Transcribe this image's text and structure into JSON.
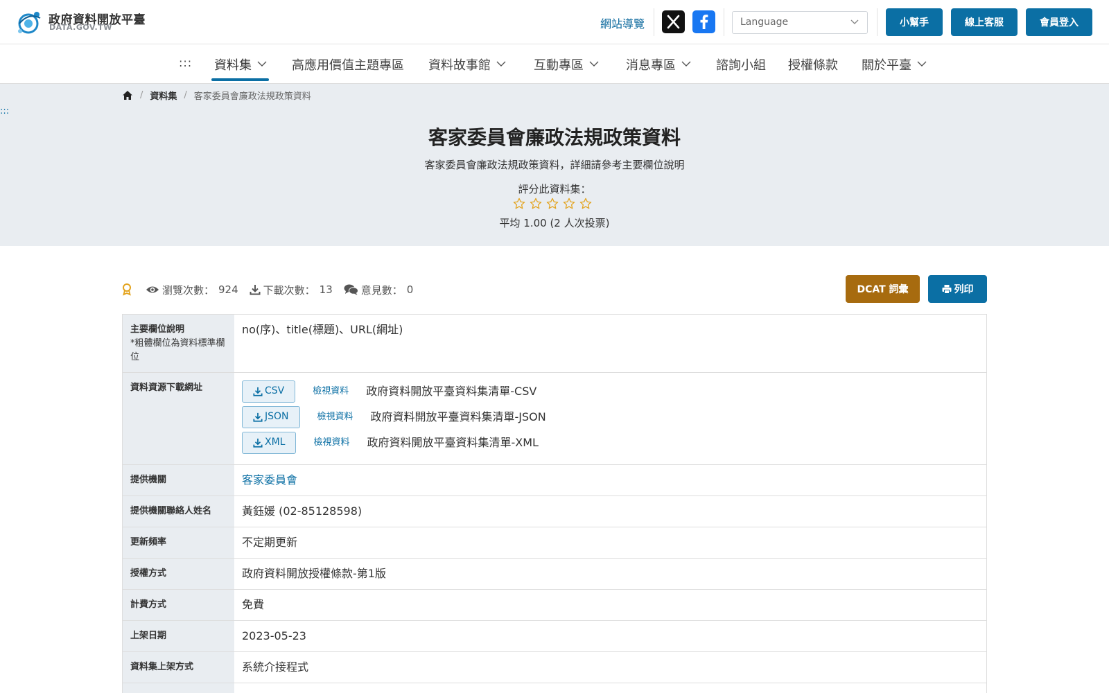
{
  "header": {
    "logo_zh": "政府資料開放平臺",
    "logo_en": "DATA.GOV.TW",
    "site_nav": "網站導覽",
    "language_placeholder": "Language",
    "buttons": [
      "小幫手",
      "線上客服",
      "會員登入"
    ],
    "colors": {
      "primary": "#0b6fa4",
      "accent": "#a76b0f"
    }
  },
  "nav": {
    "accesskey": ":::",
    "items": [
      {
        "label": "資料集",
        "dropdown": true,
        "active": true
      },
      {
        "label": "高應用價值主題專區",
        "dropdown": false
      },
      {
        "label": "資料故事館",
        "dropdown": true
      },
      {
        "label": "互動專區",
        "dropdown": true
      },
      {
        "label": "消息專區",
        "dropdown": true
      },
      {
        "label": "諮詢小組",
        "dropdown": false
      },
      {
        "label": "授權條款",
        "dropdown": false
      },
      {
        "label": "關於平臺",
        "dropdown": true
      }
    ]
  },
  "breadcrumb": [
    "資料集",
    "客家委員會廉政法規政策資料"
  ],
  "side_accesskey": ":::",
  "dataset": {
    "title": "客家委員會廉政法規政策資料",
    "description": "客家委員會廉政法規政策資料，詳細請參考主要欄位說明",
    "rating_label": "評分此資料集：",
    "rating_value": 1.0,
    "rating_max": 5,
    "rating_summary": "平均 1.00 (2 人次投票)"
  },
  "stats": {
    "views_label": "瀏覽次數：",
    "views": "924",
    "downloads_label": "下載次數：",
    "downloads": "13",
    "comments_label": "意見數：",
    "comments": "0"
  },
  "actions": {
    "dcat": "DCAT 詞彙",
    "print": "列印"
  },
  "table": {
    "main_fields": {
      "label": "主要欄位說明",
      "note": "*粗體欄位為資料標準欄位",
      "value": "no(序)、title(標題)、URL(網址)"
    },
    "resources": {
      "label": "資料資源下載網址",
      "view_label": "檢視資料",
      "items": [
        {
          "format": "CSV",
          "name": "政府資料開放平臺資料集清單-CSV"
        },
        {
          "format": "JSON",
          "name": "政府資料開放平臺資料集清單-JSON"
        },
        {
          "format": "XML",
          "name": "政府資料開放平臺資料集清單-XML"
        }
      ]
    },
    "rows": [
      {
        "label": "提供機關",
        "value": "客家委員會",
        "link": true
      },
      {
        "label": "提供機關聯絡人姓名",
        "value": "黃鈺媛 (02-85128598)"
      },
      {
        "label": "更新頻率",
        "value": "不定期更新"
      },
      {
        "label": "授權方式",
        "value": "政府資料開放授權條款-第1版"
      },
      {
        "label": "計費方式",
        "value": "免費"
      },
      {
        "label": "上架日期",
        "value": "2023-05-23"
      },
      {
        "label": "資料集上架方式",
        "value": "系統介接程式"
      }
    ]
  }
}
